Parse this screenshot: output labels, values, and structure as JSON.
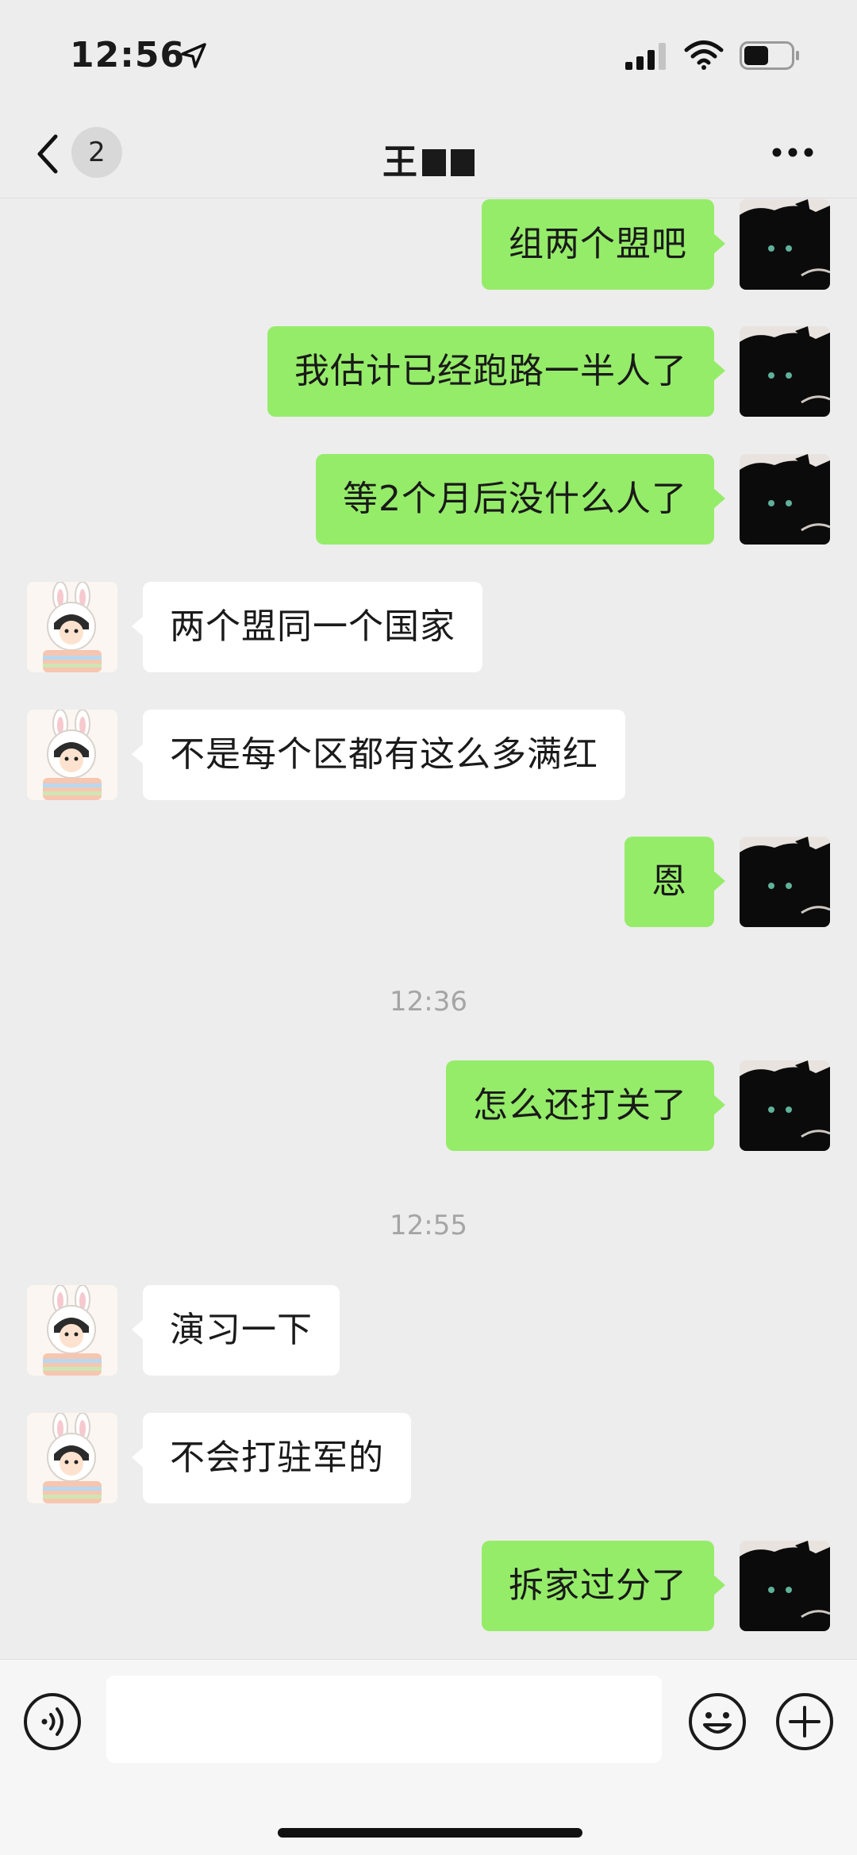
{
  "status_bar": {
    "time": "12:56"
  },
  "nav": {
    "badge": "2",
    "title": "王"
  },
  "colors": {
    "self_bubble": "#95ec69",
    "other_bubble": "#ffffff",
    "background": "#ededed"
  },
  "messages": [
    {
      "from": "self",
      "text": "组两个盟吧"
    },
    {
      "from": "self",
      "text": "我估计已经跑路一半人了"
    },
    {
      "from": "self",
      "text": "等2个月后没什么人了"
    },
    {
      "from": "other",
      "text": "两个盟同一个国家"
    },
    {
      "from": "other",
      "text": "不是每个区都有这么多满红"
    },
    {
      "from": "self",
      "text": "恩"
    },
    {
      "from": "self",
      "text": "怎么还打关了"
    },
    {
      "from": "other",
      "text": "演习一下"
    },
    {
      "from": "other",
      "text": "不会打驻军的"
    },
    {
      "from": "self",
      "text": "拆家过分了"
    }
  ],
  "timestamps": [
    "12:36",
    "12:55"
  ],
  "input": {
    "value": "",
    "placeholder": ""
  },
  "icons": {
    "location": "location-arrow-icon",
    "signal": "signal-icon",
    "wifi": "wifi-icon",
    "battery": "battery-icon",
    "back": "chevron-left-icon",
    "more": "more-dots-icon",
    "voice": "voice-icon",
    "emoji": "emoji-icon",
    "plus": "plus-icon"
  }
}
